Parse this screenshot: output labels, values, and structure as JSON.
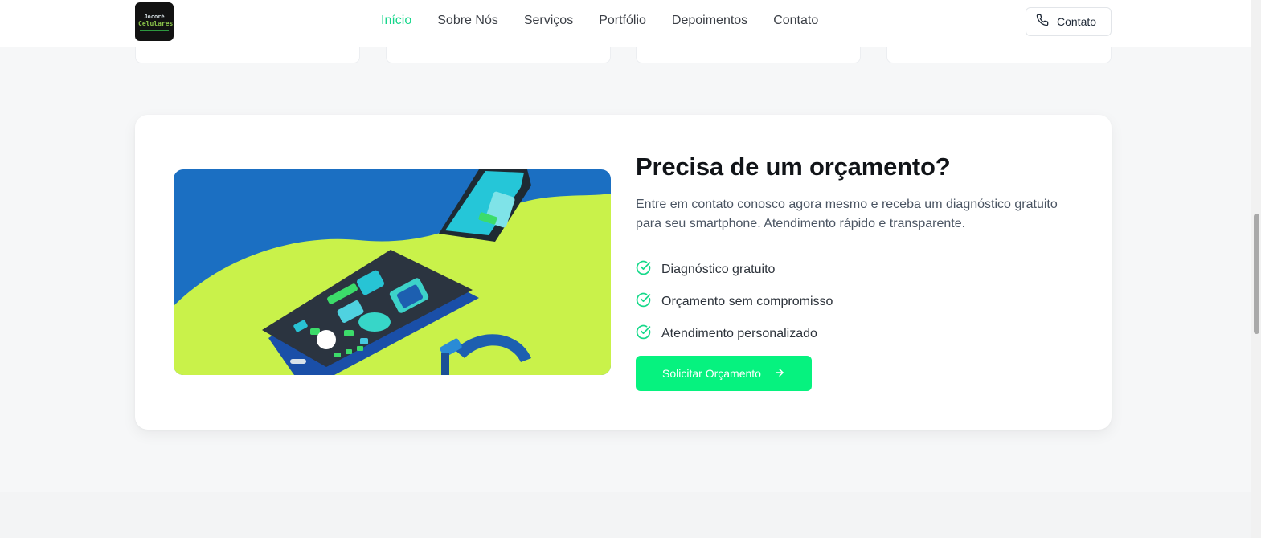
{
  "header": {
    "logo": {
      "line1": "Jocoré",
      "line2": "Celulares"
    },
    "nav": [
      {
        "label": "Início",
        "active": true
      },
      {
        "label": "Sobre Nós",
        "active": false
      },
      {
        "label": "Serviços",
        "active": false
      },
      {
        "label": "Portfólio",
        "active": false
      },
      {
        "label": "Depoimentos",
        "active": false
      },
      {
        "label": "Contato",
        "active": false
      }
    ],
    "contact_button": {
      "label": "Contato",
      "icon": "phone-icon"
    }
  },
  "cta": {
    "title": "Precisa de um orçamento?",
    "description": "Entre em contato conosco agora mesmo e receba um diagnóstico gratuito para seu smartphone. Atendimento rápido e transparente.",
    "features": [
      {
        "label": "Diagnóstico gratuito",
        "icon": "check-circle-icon"
      },
      {
        "label": "Orçamento sem compromisso",
        "icon": "check-circle-icon"
      },
      {
        "label": "Atendimento personalizado",
        "icon": "check-circle-icon"
      }
    ],
    "button": {
      "label": "Solicitar Orçamento",
      "icon": "arrow-right-icon"
    },
    "image": {
      "icon": "smartphone-repair-illustration"
    }
  },
  "colors": {
    "accent": "#06f27f",
    "nav_active": "#17d68b",
    "check": "#16d98a",
    "image_blue": "#1b6fc2",
    "image_lime": "#c9f24a"
  }
}
